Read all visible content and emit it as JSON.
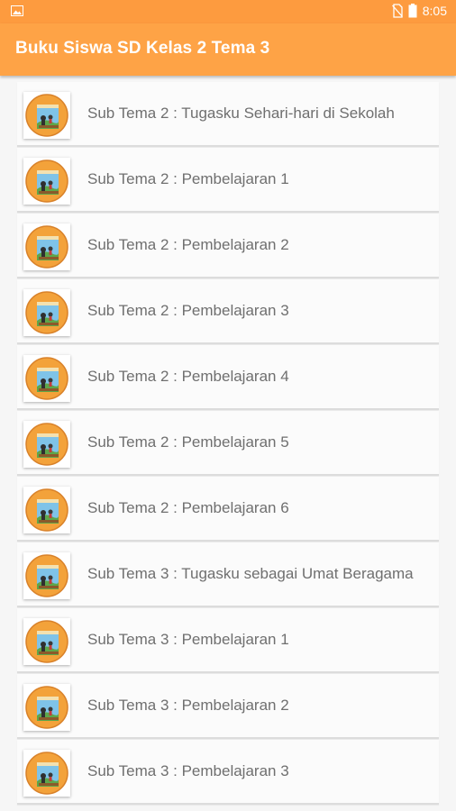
{
  "status_bar": {
    "time": "8:05",
    "left_icon": "image-icon",
    "icons": [
      "sim-blocked-icon",
      "battery-icon"
    ]
  },
  "app_bar": {
    "title": "Buku Siswa SD Kelas 2 Tema 3",
    "color": "#fea346"
  },
  "list": {
    "items": [
      {
        "label": "Sub Tema 2 : Tugasku Sehari-hari di Sekolah",
        "icon": "book-cover-thumbnail"
      },
      {
        "label": "Sub Tema 2 : Pembelajaran 1",
        "icon": "book-cover-thumbnail"
      },
      {
        "label": "Sub Tema 2 : Pembelajaran 2",
        "icon": "book-cover-thumbnail"
      },
      {
        "label": "Sub Tema 2 : Pembelajaran 3",
        "icon": "book-cover-thumbnail"
      },
      {
        "label": "Sub Tema 2 : Pembelajaran 4",
        "icon": "book-cover-thumbnail"
      },
      {
        "label": "Sub Tema 2 : Pembelajaran 5",
        "icon": "book-cover-thumbnail"
      },
      {
        "label": "Sub Tema 2 : Pembelajaran 6",
        "icon": "book-cover-thumbnail"
      },
      {
        "label": "Sub Tema 3 : Tugasku sebagai Umat Beragama",
        "icon": "book-cover-thumbnail"
      },
      {
        "label": "Sub Tema 3 : Pembelajaran 1",
        "icon": "book-cover-thumbnail"
      },
      {
        "label": "Sub Tema 3 : Pembelajaran 2",
        "icon": "book-cover-thumbnail"
      },
      {
        "label": "Sub Tema 3 : Pembelajaran 3",
        "icon": "book-cover-thumbnail"
      }
    ]
  }
}
